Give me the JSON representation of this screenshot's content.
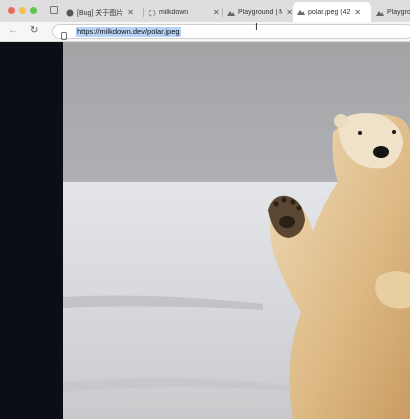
{
  "browser": {
    "tabs": [
      {
        "label": "[Bug] 关于图片",
        "icon": "github-icon"
      },
      {
        "label": "milkdown",
        "icon": "loading-icon"
      },
      {
        "label": "Playground | M",
        "icon": "milkdown-logo-icon"
      },
      {
        "label": "polar.jpeg (42",
        "icon": "milkdown-logo-icon",
        "active": true
      },
      {
        "label": "Playgro",
        "icon": "milkdown-logo-icon"
      }
    ],
    "address": "https://milkdown.dev/polar.jpeg"
  },
  "image": {
    "subject": "polar bear waving on snow field",
    "colors": {
      "sky": "#a6a8aa",
      "snow": "#d3d5d8",
      "fur": "#e4c79a",
      "page_bg": "#0b0f15"
    }
  }
}
